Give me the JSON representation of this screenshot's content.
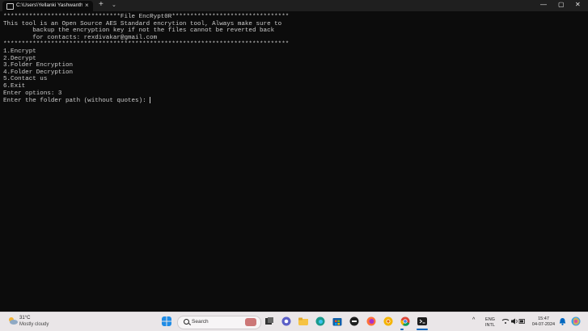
{
  "window": {
    "tab_title": "C:\\Users\\Yellanki Yashwanth\\I",
    "tab_close": "×",
    "new_tab": "+",
    "tab_dropdown": "⌄",
    "minimize": "—",
    "maximize": "▢",
    "close": "✕"
  },
  "terminal": {
    "lines": [
      "********************************File EncRypt0R********************************",
      "This tool is an Open Source AES Standard encrytion tool, Always make sure to",
      "        backup the encryption key if not the files cannot be reverted back",
      "        for contacts: rexdivakar@gmail.com",
      "******************************************************************************",
      "1.Encrypt",
      "2.Decrypt",
      "3.Folder Encryption",
      "4.Folder Decryption",
      "5.Contact us",
      "6.Exit",
      "Enter options: 3"
    ],
    "prompt": "Enter the folder path (without quotes): "
  },
  "taskbar": {
    "weather_temp": "31°C",
    "weather_condition": "Mostly cloudy",
    "search_label": "Search",
    "lang_line1": "ENG",
    "lang_line2": "INTL",
    "time": "15:47",
    "date": "04-07-2024",
    "icons": [
      "start-icon",
      "task-view-icon",
      "chat-icon",
      "file-explorer-icon",
      "edge-icon",
      "microsoft-store-icon",
      "dell-icon",
      "firefox-icon",
      "chrome-canary-icon",
      "chrome-icon",
      "terminal-icon"
    ]
  },
  "colors": {
    "terminal_bg": "#0c0c0c",
    "terminal_fg": "#cccccc",
    "titlebar_bg": "#1f1f1f",
    "taskbar_bg": "#eae6e8",
    "accent": "#0067c0"
  }
}
